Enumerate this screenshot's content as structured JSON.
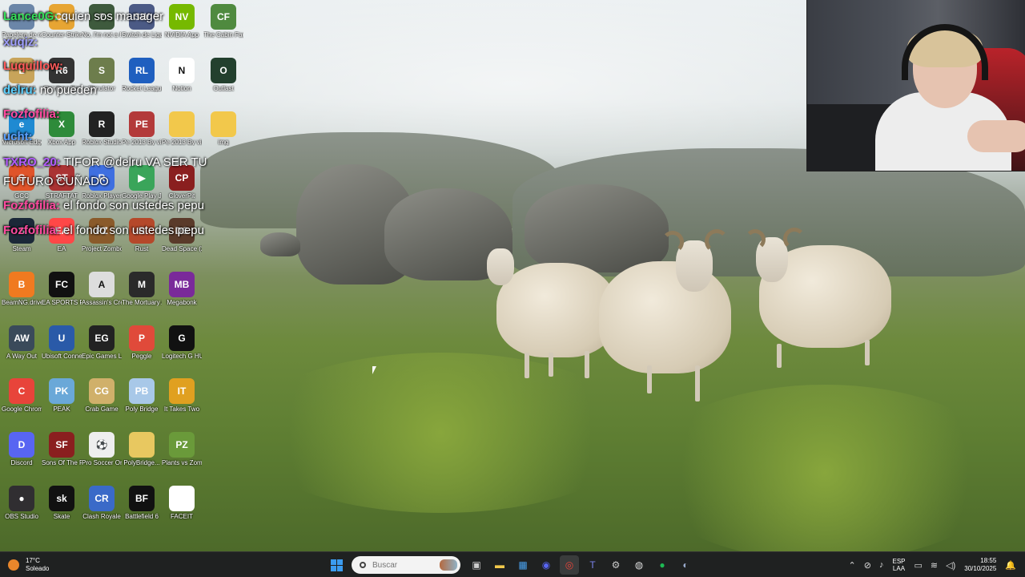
{
  "desktop_icons": [
    {
      "label": "Papelera de reciclaje",
      "glyph": "♻",
      "color": "#6b86a8"
    },
    {
      "label": "Counter-Strike 2",
      "glyph": "CS",
      "color": "#e7a533"
    },
    {
      "label": "No, I'm not a Human",
      "glyph": "?",
      "color": "#3e5a3d"
    },
    {
      "label": "Switch de Ligas",
      "glyph": "SW",
      "color": "#4b5a85"
    },
    {
      "label": "NVIDIA App",
      "glyph": "NV",
      "color": "#76b900"
    },
    {
      "label": "The Cabin Factory",
      "glyph": "CF",
      "color": "#4f8a3f"
    },
    {
      "label": "LoL Final",
      "glyph": "L",
      "color": "#c8a45a"
    },
    {
      "label": "Rainbow Six",
      "glyph": "R6",
      "color": "#333"
    },
    {
      "label": "Simulator",
      "glyph": "S",
      "color": "#6d7d4c"
    },
    {
      "label": "Rocket League",
      "glyph": "RL",
      "color": "#1f5fbf"
    },
    {
      "label": "Notion",
      "glyph": "N",
      "color": "#ffffff"
    },
    {
      "label": "Outlast",
      "glyph": "O",
      "color": "#23402e"
    },
    {
      "label": "Microsoft Edge",
      "glyph": "e",
      "color": "#1f8ad2"
    },
    {
      "label": "Xbox App",
      "glyph": "X",
      "color": "#2e8b3a"
    },
    {
      "label": "Roblox Studio",
      "glyph": "R",
      "color": "#222"
    },
    {
      "label": "Pe 2013 By vintage Ga...",
      "glyph": "PE",
      "color": "#b33a3a"
    },
    {
      "label": "Pe 2013 By vintage Ga...",
      "glyph": "",
      "color": "#f2c84b"
    },
    {
      "label": "img",
      "glyph": "",
      "color": "#f2c84b"
    },
    {
      "label": "GCC",
      "glyph": "G",
      "color": "#e0542a"
    },
    {
      "label": "STRAFTAT",
      "glyph": "ST",
      "color": "#a33"
    },
    {
      "label": "Roblox Player",
      "glyph": "R",
      "color": "#3f6fe0"
    },
    {
      "label": "Google Play Juegos Beta",
      "glyph": "▶",
      "color": "#3aa55a"
    },
    {
      "label": "CloverPit",
      "glyph": "CP",
      "color": "#8a1f1f"
    },
    {
      "label": "Steam",
      "glyph": "S",
      "color": "#1b2838"
    },
    {
      "label": "EA",
      "glyph": "EA",
      "color": "#ff4747"
    },
    {
      "label": "Project Zomboid",
      "glyph": "PZ",
      "color": "#8a5a2a"
    },
    {
      "label": "Rust",
      "glyph": "R",
      "color": "#b5482a"
    },
    {
      "label": "Dead Space (2023)",
      "glyph": "DS",
      "color": "#5a3a2a"
    },
    {
      "label": "BeamNG.drive",
      "glyph": "B",
      "color": "#f07a20"
    },
    {
      "label": "EA SPORTS FC 26",
      "glyph": "FC",
      "color": "#111"
    },
    {
      "label": "Assassin's Creed II",
      "glyph": "A",
      "color": "#ddd"
    },
    {
      "label": "The Mortuary Assistant",
      "glyph": "M",
      "color": "#2a2a2a"
    },
    {
      "label": "Megabonk",
      "glyph": "MB",
      "color": "#7a2a9a"
    },
    {
      "label": "A Way Out",
      "glyph": "AW",
      "color": "#3a4a5a"
    },
    {
      "label": "Ubisoft Connect",
      "glyph": "U",
      "color": "#2a5aa8"
    },
    {
      "label": "Epic Games Launcher",
      "glyph": "EG",
      "color": "#222"
    },
    {
      "label": "Peggle",
      "glyph": "P",
      "color": "#e04a3a"
    },
    {
      "label": "Logitech G HUB",
      "glyph": "G",
      "color": "#111"
    },
    {
      "label": "Google Chrome",
      "glyph": "C",
      "color": "#e8443a"
    },
    {
      "label": "PEAK",
      "glyph": "PK",
      "color": "#6aa8d8"
    },
    {
      "label": "Crab Game",
      "glyph": "CG",
      "color": "#d0b06a"
    },
    {
      "label": "Poly Bridge",
      "glyph": "PB",
      "color": "#a8c8e8"
    },
    {
      "label": "It Takes Two",
      "glyph": "IT",
      "color": "#e0a020"
    },
    {
      "label": "Discord",
      "glyph": "D",
      "color": "#5865f2"
    },
    {
      "label": "Sons Of The Forest",
      "glyph": "SF",
      "color": "#8a1f1f"
    },
    {
      "label": "Pro Soccer Online",
      "glyph": "⚽",
      "color": "#eee"
    },
    {
      "label": "PolyBridge...",
      "glyph": "",
      "color": "#e8c860"
    },
    {
      "label": "Plants vs Zombies Tr...",
      "glyph": "PZ",
      "color": "#6a9a3a"
    },
    {
      "label": "OBS Studio",
      "glyph": "●",
      "color": "#302e31"
    },
    {
      "label": "Skate",
      "glyph": "sk",
      "color": "#111"
    },
    {
      "label": "Clash Royale",
      "glyph": "CR",
      "color": "#3a6ac8"
    },
    {
      "label": "Battlefield 6",
      "glyph": "BF",
      "color": "#111"
    },
    {
      "label": "FACEIT",
      "glyph": "",
      "color": "#ffffff"
    }
  ],
  "chat": [
    {
      "user": "Lance0G:",
      "msg": " quien sos manager",
      "color": "#36e05a"
    },
    {
      "user": "xuqiz:",
      "msg": "",
      "color": "#a0a0ff"
    },
    {
      "user": "Luquillow:",
      "msg": "",
      "color": "#ff5a5a"
    },
    {
      "user": "delru:",
      "msg": " no pueden",
      "color": "#5ad0ff"
    },
    {
      "user": "Fozfofilia:",
      "msg": "",
      "color": "#ff4aa0"
    },
    {
      "user": "ucht:",
      "msg": "",
      "color": "#5aa0ff"
    },
    {
      "user": "TXRO_20:",
      "msg": " TIFOR @delru VA SER TU",
      "color": "#b45aff"
    },
    {
      "user": "",
      "msg": "FUTURO CUÑADO",
      "color": "#ffffff"
    },
    {
      "user": "Fozfofilia:",
      "msg": " el fondo son ustedes pepu",
      "color": "#ff4aa0"
    },
    {
      "user": "Fozfofilia:",
      "msg": " el fondo son ustedes pepu",
      "color": "#ff4aa0"
    }
  ],
  "taskbar": {
    "weather_temp": "17°C",
    "weather_desc": "Soleado",
    "search_placeholder": "Buscar",
    "apps": [
      {
        "name": "start-button",
        "glyph": ""
      },
      {
        "name": "task-view-button",
        "glyph": "▣"
      },
      {
        "name": "file-explorer-button",
        "glyph": "📁"
      },
      {
        "name": "microsoft-store-button",
        "glyph": "▦"
      },
      {
        "name": "discord-taskbar-button",
        "glyph": "◉"
      },
      {
        "name": "chrome-taskbar-button",
        "glyph": "◎"
      },
      {
        "name": "teams-taskbar-button",
        "glyph": "T"
      },
      {
        "name": "settings-taskbar-button",
        "glyph": "⚙"
      },
      {
        "name": "obs-taskbar-button",
        "glyph": "●"
      },
      {
        "name": "spotify-taskbar-button",
        "glyph": "♫"
      },
      {
        "name": "steam-taskbar-button",
        "glyph": "S"
      }
    ],
    "lang_line1": "ESP",
    "lang_line2": "LAA",
    "time": "18:55",
    "date": "30/10/2025"
  },
  "colors": {
    "taskbar_bg": "#1f2121",
    "accent": "#3b9cf0"
  }
}
